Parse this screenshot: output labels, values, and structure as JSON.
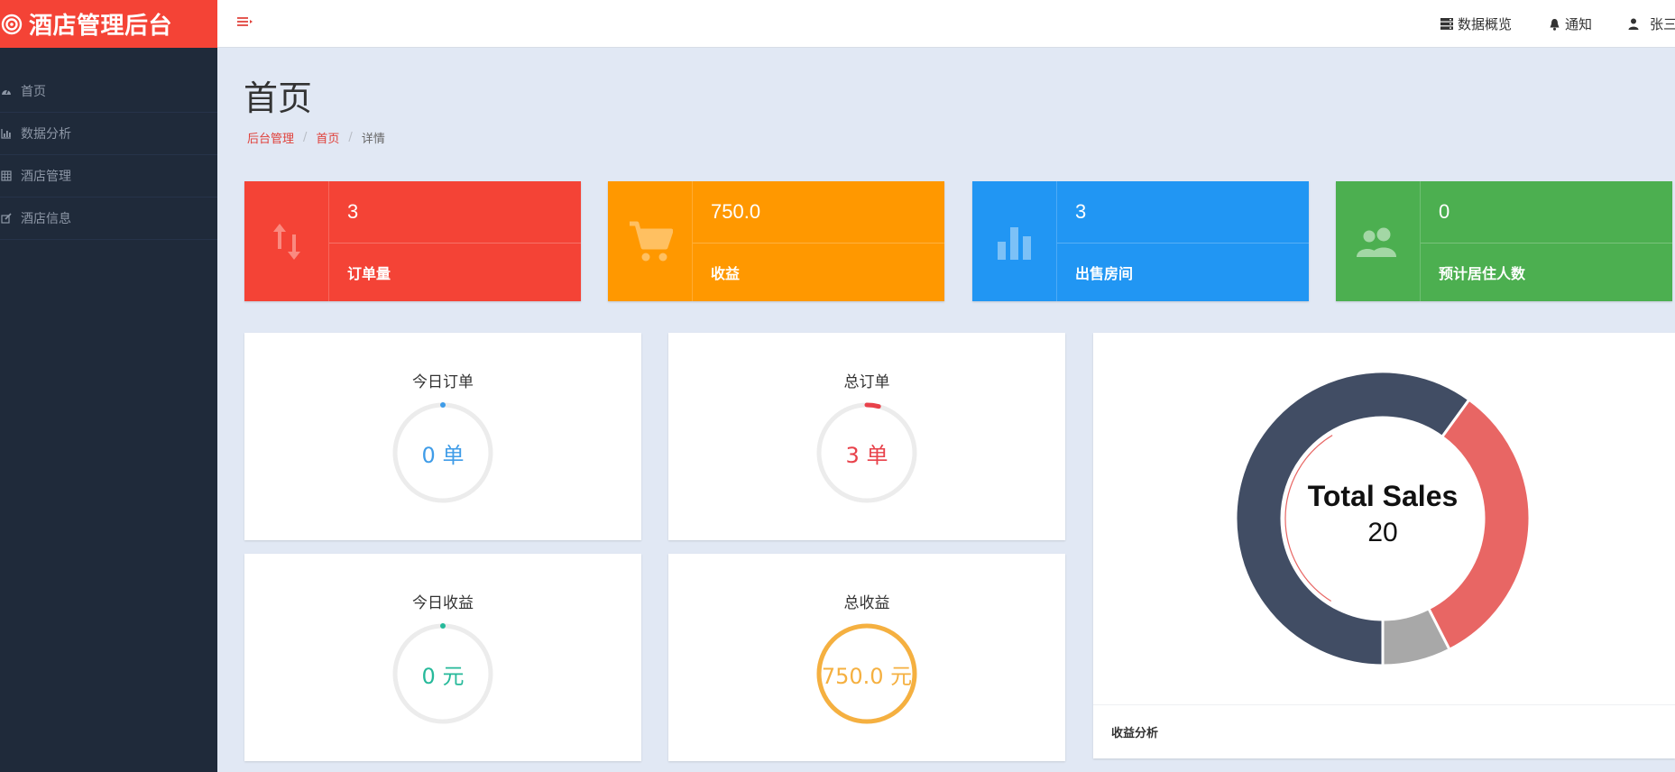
{
  "brand": {
    "title": "酒店管理后台",
    "color": "#f44336"
  },
  "sidebar": {
    "items": [
      {
        "label": "首页",
        "icon": "dashboard-icon"
      },
      {
        "label": "数据分析",
        "icon": "bar-chart-icon"
      },
      {
        "label": "酒店管理",
        "icon": "grid-icon"
      },
      {
        "label": "酒店信息",
        "icon": "edit-icon"
      }
    ]
  },
  "topbar": {
    "overview": "数据概览",
    "notify": "通知",
    "user": "张三"
  },
  "page": {
    "title": "首页",
    "breadcrumb": [
      "后台管理",
      "首页",
      "详情"
    ]
  },
  "stats": [
    {
      "value": "3",
      "label": "订单量",
      "icon": "swap-vertical-icon",
      "color": "#f44336"
    },
    {
      "value": "750.0",
      "label": "收益",
      "icon": "shopping-cart-icon",
      "color": "#ff9800"
    },
    {
      "value": "3",
      "label": "出售房间",
      "icon": "bar-chart-icon",
      "color": "#2196f3"
    },
    {
      "value": "0",
      "label": "预计居住人数",
      "icon": "people-icon",
      "color": "#4caf50"
    }
  ],
  "metrics": {
    "today_orders": {
      "title": "今日订单",
      "text": "0 单",
      "fraction": 0.0,
      "color": "#3f9ce8"
    },
    "total_orders": {
      "title": "总订单",
      "text": "3 单",
      "fraction": 0.04,
      "color": "#e8414a"
    },
    "today_income": {
      "title": "今日收益",
      "text": "0 元",
      "fraction": 0.0,
      "color": "#26b99a"
    },
    "total_income": {
      "title": "总收益",
      "text": "750.0 元",
      "fraction": 1.0,
      "color": "#f5b040"
    }
  },
  "chart_data": {
    "type": "pie",
    "center_title": "Total Sales",
    "center_value": "20",
    "caption": "收益分析",
    "series": [
      {
        "value": 12,
        "color": "#414d64"
      },
      {
        "value": 6.5,
        "color": "#e86664"
      },
      {
        "value": 1.5,
        "color": "#a8a8a8"
      }
    ]
  }
}
